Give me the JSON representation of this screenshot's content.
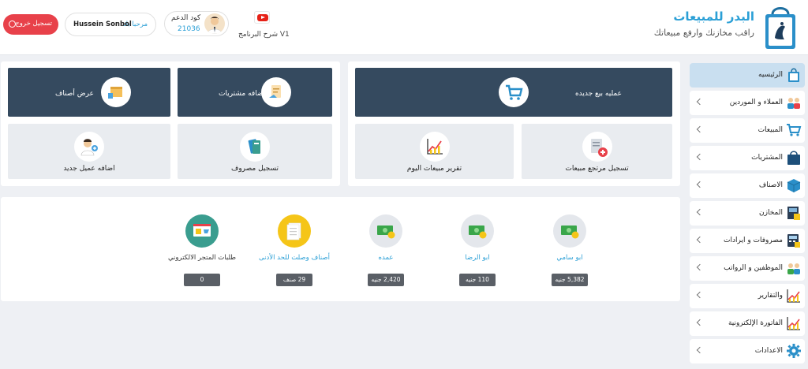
{
  "header": {
    "brand_title": "البدر للمبيعات",
    "brand_subtitle": "راقب مخازنك وارفع مبيعاتك",
    "tutorial_label": "شرح البرنامج V1",
    "support_label": "كود الدعم",
    "support_code": "21036",
    "welcome_label": "مرحبا بك",
    "user_name": "Hussein Sonbol",
    "logout_label": "تسجيل خروج"
  },
  "sidebar": {
    "items": [
      {
        "label": "الرئيسيه",
        "icon": "home-bag-icon",
        "active": true
      },
      {
        "label": "العملاء و الموردين",
        "icon": "people-icon"
      },
      {
        "label": "المبيعات",
        "icon": "cart-icon"
      },
      {
        "label": "المشتريات",
        "icon": "bag-icon"
      },
      {
        "label": "الاصناف",
        "icon": "boxes-icon"
      },
      {
        "label": "المخازن",
        "icon": "warehouse-icon"
      },
      {
        "label": "مصروفات و ايرادات",
        "icon": "calculator-icon"
      },
      {
        "label": "الموظفين و الرواتب",
        "icon": "employees-icon"
      },
      {
        "label": "والتقارير",
        "icon": "chart-icon"
      },
      {
        "label": "الفاتورة الإلكترونية",
        "icon": "invoice-chart-icon"
      },
      {
        "label": "الاعدادات",
        "icon": "gear-icon"
      }
    ]
  },
  "quick_actions": {
    "new_sale": "عمليه بيع جديده",
    "sales_return": "تسجيل مرتجع مبيعات",
    "daily_report": "تقرير مبيعات اليوم",
    "add_purchases": "اضافه مشتريات",
    "view_items": "عرض أصناف",
    "add_customer": "اضافه عميل جديد",
    "add_expense": "تسجيل مصروف"
  },
  "stats": [
    {
      "name": "ابو سامي",
      "value": "5,382 جنيه"
    },
    {
      "name": "ابو الرضا",
      "value": "110 جنيه"
    },
    {
      "name": "عمده",
      "value": "2,420 جنيه"
    },
    {
      "name": "أصناف وصلت للحد الأدنى",
      "value": "29 صنف"
    },
    {
      "name": "طلبات المتجر الالكتروني",
      "value": "0"
    }
  ],
  "colors": {
    "accent": "#2a9fd6",
    "dark_tile": "#354a5f",
    "logout": "#e8414a",
    "money_green": "#3aa64a",
    "yellow": "#f5c518",
    "teal": "#3a9d8f"
  }
}
